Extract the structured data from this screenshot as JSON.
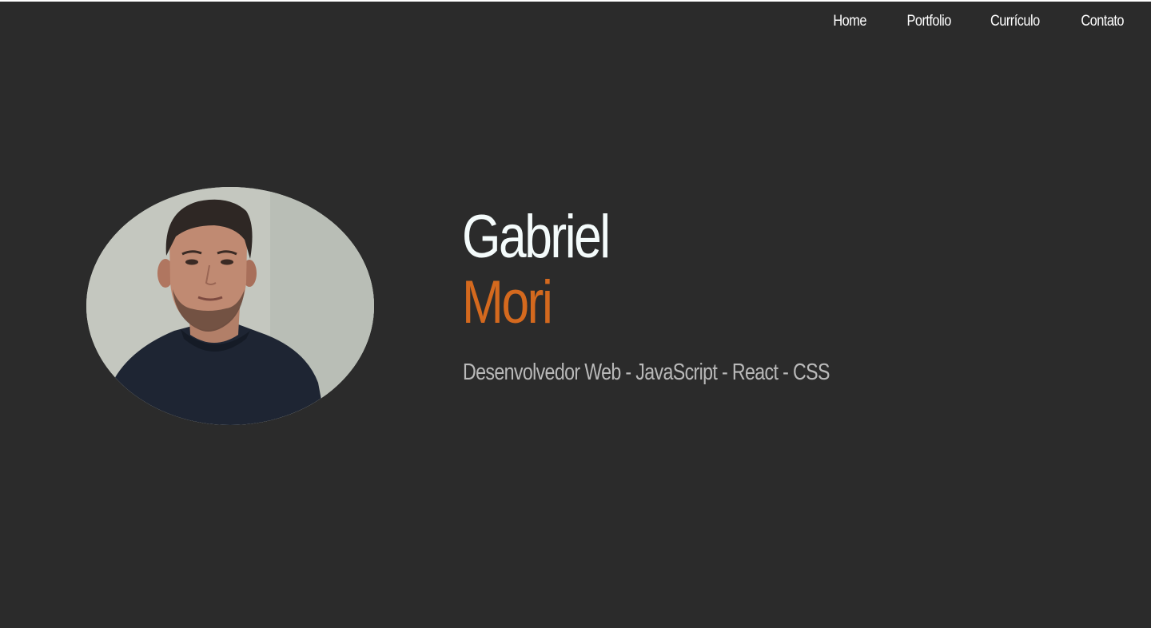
{
  "nav": {
    "items": [
      {
        "label": "Home"
      },
      {
        "label": "Portfolio"
      },
      {
        "label": "Currículo"
      },
      {
        "label": "Contato"
      }
    ]
  },
  "hero": {
    "first_name": "Gabriel",
    "last_name": "Mori",
    "subtitle": "Desenvolvedor Web - JavaScript - React - CSS"
  },
  "colors": {
    "background": "#2b2b2b",
    "accent": "#d4691e",
    "name": "#f4fbfb",
    "subtitle": "#b9b9b9"
  }
}
